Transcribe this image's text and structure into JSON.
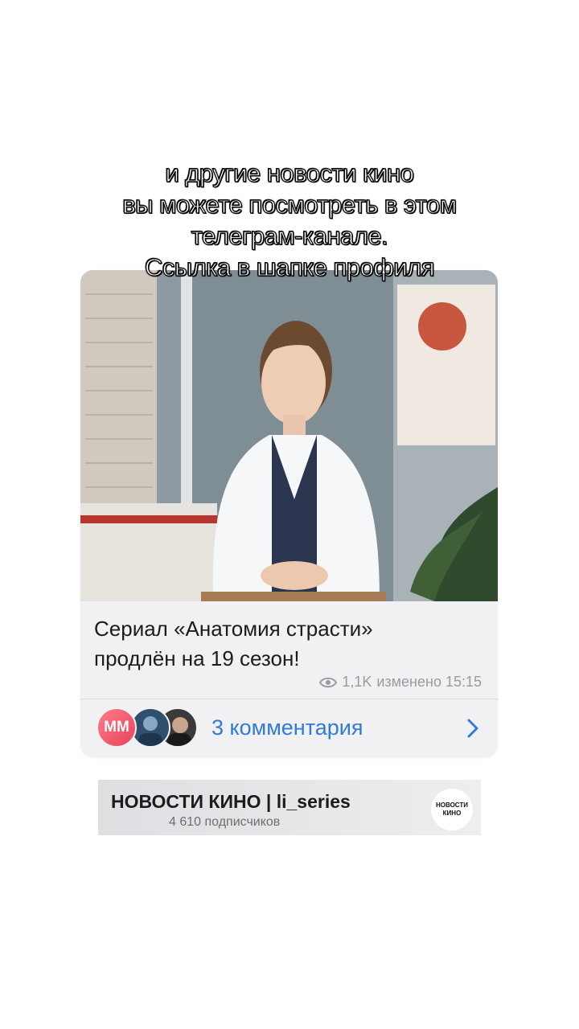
{
  "caption": {
    "line1": "и другие новости кино",
    "line2": "вы можете посмотреть в этом",
    "line3": "телеграм-канале.",
    "line4": "Ссылка в шапке профиля"
  },
  "post": {
    "text_line1": "Сериал «Анатомия страсти»",
    "text_line2": "продлён на 19 сезон!",
    "views": "1,1K",
    "edited_time": "изменено 15:15",
    "comments_label": "3 комментария",
    "avatar_initials": "MM"
  },
  "channel": {
    "title": "НОВОСТИ КИНО | li_series",
    "subscribers": "4 610 подписчиков",
    "logo_line1": "НОВОСТИ",
    "logo_line2": "КИНО"
  },
  "colors": {
    "accent": "#2f7cd6",
    "card_bg": "#f1f1f3",
    "meta_text": "#9a9aa0"
  },
  "icons": [
    "eye-icon",
    "chevron-right-icon"
  ]
}
